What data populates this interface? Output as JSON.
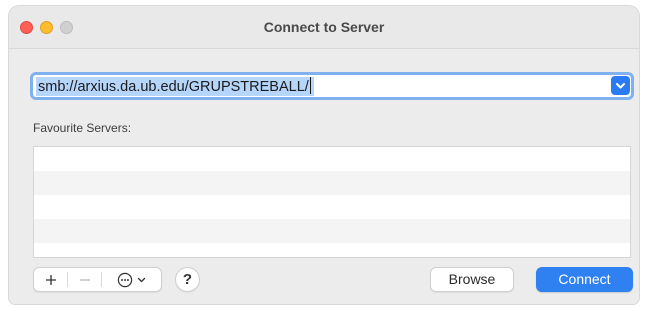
{
  "window": {
    "title": "Connect to Server"
  },
  "address": {
    "value": "smb://arxius.da.ub.edu/GRUPSTREBALL/"
  },
  "favourites": {
    "label": "Favourite Servers:",
    "items": []
  },
  "toolbar": {
    "add_icon": "plus-icon",
    "remove_icon": "minus-icon",
    "more_icon": "ellipsis-circle-icon",
    "help_label": "?",
    "browse_label": "Browse",
    "connect_label": "Connect"
  },
  "colors": {
    "accent": "#2f80f0",
    "selection": "#b5d5fb",
    "close": "#fe5f57",
    "minimize": "#febc2e",
    "zoom_inactive": "#d0d0d0"
  }
}
